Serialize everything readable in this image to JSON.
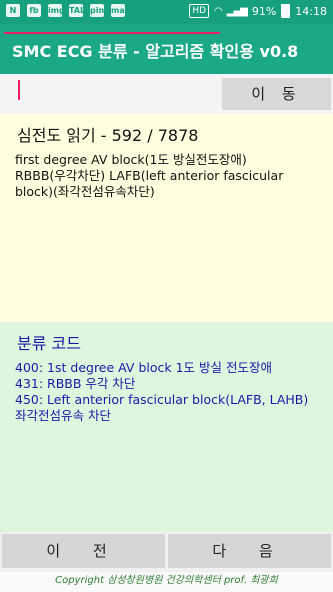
{
  "status_bar": {
    "battery_text": "91%",
    "time": "14:18",
    "network": "HD",
    "notifications": [
      "N",
      "fb",
      "img",
      "TALK",
      "pin",
      "mail"
    ]
  },
  "app": {
    "title": "SMC ECG 분류 - 알고리즘 확인용 v0.8"
  },
  "search": {
    "value": "",
    "button_label": "이 동"
  },
  "reading": {
    "heading": "심전도 읽기 -  592 / 7878",
    "text": "first degree AV block(1도 방실전도장애)\nRBBB(우각차단)  LAFB(left anterior fascicular block)(좌각전섬유속차단)"
  },
  "codes": {
    "heading": "분류 코드",
    "items": [
      "400: 1st degree AV block 1도 방실 전도장애",
      "431: RBBB 우각 차단",
      "450: Left anterior fascicular block(LAFB, LAHB) 좌각전섬유속 차단"
    ]
  },
  "nav": {
    "prev_label": "이 전",
    "next_label": "다 음"
  },
  "footer": {
    "copyright": "Copyright 삼성창원병원 건강의학센터 prof. 최광희"
  },
  "colors": {
    "status_bar": "#17a07d",
    "app_bar": "#1aa886",
    "reading_bg": "#ffffe0",
    "codes_bg": "#ddf6dd",
    "codes_text": "#1a1aa8",
    "accent": "#e91e63"
  }
}
